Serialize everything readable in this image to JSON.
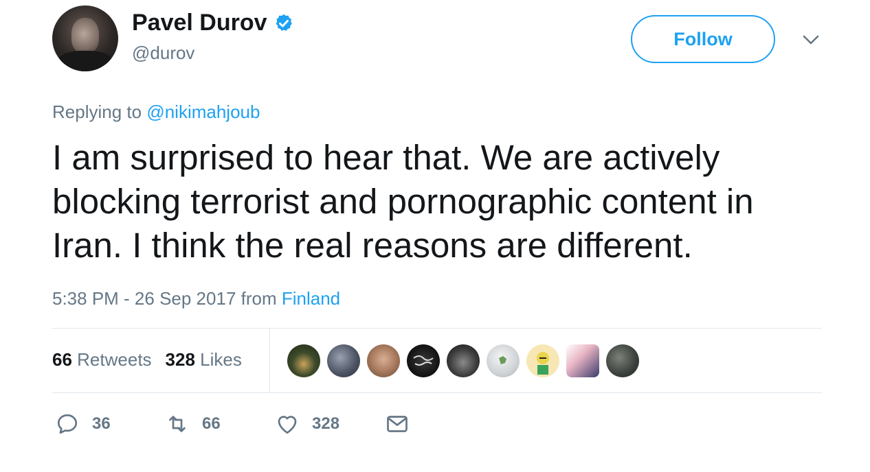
{
  "author": {
    "name": "Pavel Durov",
    "handle": "@durov",
    "verified": true
  },
  "follow_label": "Follow",
  "reply_context": {
    "prefix": "Replying to",
    "mention": "@nikimahjoub"
  },
  "tweet": {
    "text": "I am surprised to hear that. We are actively blocking terrorist and pornographic content in Iran. I think the real reasons are different."
  },
  "meta": {
    "time_date": "5:38 PM - 26 Sep 2017 from",
    "location": "Finland"
  },
  "stats": {
    "retweets_count": "66",
    "retweets_label": "Retweets",
    "likes_count": "328",
    "likes_label": "Likes"
  },
  "liker_avatars": [
    "forest-photo",
    "gray-portrait",
    "smiling-man",
    "calligraphy-dark",
    "hat-portrait",
    "globe-map",
    "cartoon-character",
    "pink-collage",
    "camera-lens"
  ],
  "actions": {
    "replies": "36",
    "retweets": "66",
    "likes": "328"
  },
  "colors": {
    "accent": "#1da1f2",
    "secondary_text": "#657786",
    "primary_text": "#14171a",
    "divider": "#e1e8ed"
  }
}
